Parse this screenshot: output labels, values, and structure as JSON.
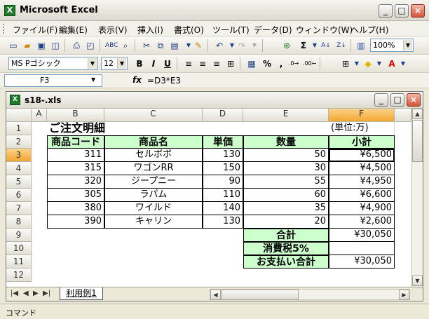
{
  "app": {
    "title": "Microsoft Excel",
    "logo": "X"
  },
  "menu": [
    "ファイル(F)",
    "編集(E)",
    "表示(V)",
    "挿入(I)",
    "書式(O)",
    "ツール(T)",
    "データ(D)",
    "ウィンドウ(W)",
    "ヘルプ(H)"
  ],
  "toolbar1": {
    "zoom": "100%",
    "sigma": "Σ"
  },
  "toolbar2": {
    "font": "MS Pゴシック",
    "size": "12",
    "bold": "B",
    "italic": "I",
    "underline": "U",
    "percent": "%",
    "comma": ","
  },
  "formula_bar": {
    "name_box": "F3",
    "fx": "fx",
    "formula": "=D3*E3"
  },
  "workbook": {
    "filename": "s18-.xls",
    "sheet_tab": "利用例1"
  },
  "columns": [
    "A",
    "B",
    "C",
    "D",
    "E",
    "F"
  ],
  "rows": [
    "1",
    "2",
    "3",
    "4",
    "5",
    "6",
    "7",
    "8",
    "9",
    "10",
    "11",
    "12"
  ],
  "sheet": {
    "title": "ご注文明細",
    "unit": "(単位:万)",
    "headers": {
      "code": "商品コード",
      "name": "商品名",
      "price": "単価",
      "qty": "数量",
      "subtotal": "小計"
    },
    "items": [
      {
        "code": "311",
        "name": "セルボボ",
        "price": "130",
        "qty": "50",
        "subtotal": "¥6,500"
      },
      {
        "code": "315",
        "name": "ワゴンRR",
        "price": "150",
        "qty": "30",
        "subtotal": "¥4,500"
      },
      {
        "code": "320",
        "name": "ジープニー",
        "price": "90",
        "qty": "55",
        "subtotal": "¥4,950"
      },
      {
        "code": "305",
        "name": "ラパム",
        "price": "110",
        "qty": "60",
        "subtotal": "¥6,600"
      },
      {
        "code": "380",
        "name": "ワイルド",
        "price": "140",
        "qty": "35",
        "subtotal": "¥4,900"
      },
      {
        "code": "390",
        "name": "キャリン",
        "price": "130",
        "qty": "20",
        "subtotal": "¥2,600"
      }
    ],
    "total_label": "合計",
    "total_value": "¥30,050",
    "tax_label": "消費税5%",
    "tax_value": "",
    "grand_label": "お支払い合計",
    "grand_value": "¥30,050"
  },
  "status": {
    "mode": "コマンド"
  },
  "colors": {
    "accent": "#ccffcc",
    "selected_header": "#f3a62f"
  }
}
